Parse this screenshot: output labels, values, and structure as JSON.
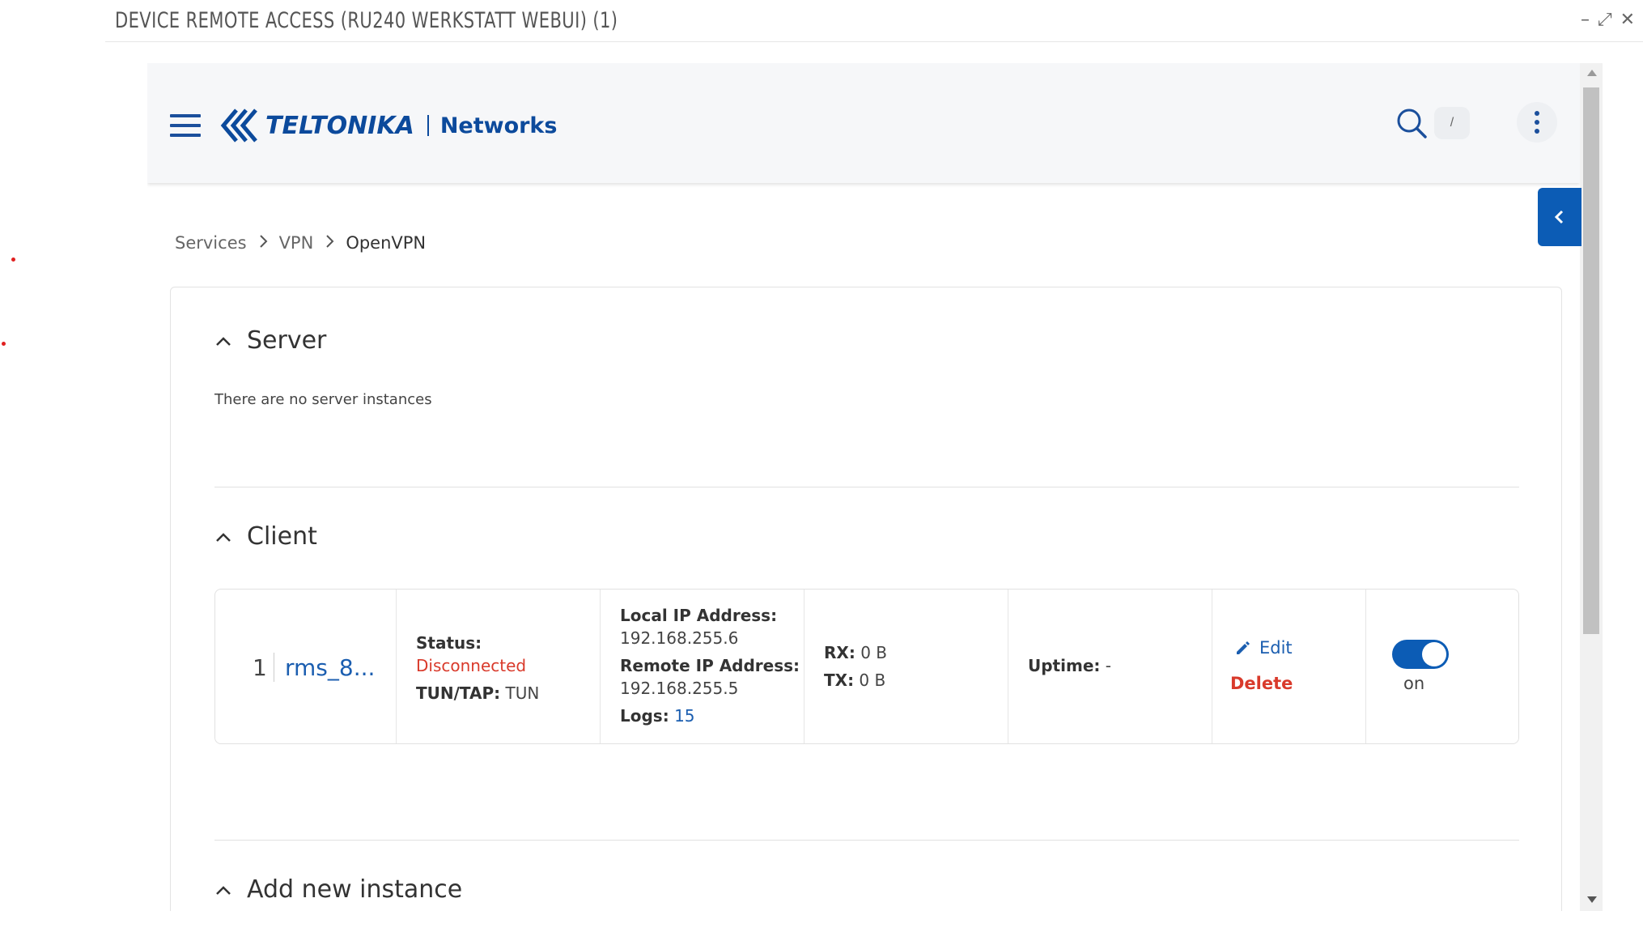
{
  "window": {
    "title": "DEVICE REMOTE ACCESS (RU240 WERKSTATT WEBUI) (1)",
    "controls": {
      "minimize": "–",
      "maximize": "⤢",
      "close": "✕"
    }
  },
  "header": {
    "brand": "TELTONIKA",
    "brand_sub": "Networks",
    "search_shortcut": "/"
  },
  "breadcrumb": [
    "Services",
    "VPN",
    "OpenVPN"
  ],
  "sections": {
    "server": {
      "title": "Server",
      "empty_text": "There are no server instances"
    },
    "client": {
      "title": "Client"
    },
    "add": {
      "title": "Add new instance"
    }
  },
  "instance": {
    "index": "1",
    "name": "rms_8...",
    "status_label": "Status:",
    "status_value": "Disconnected",
    "tuntap_label": "TUN/TAP:",
    "tuntap_value": "TUN",
    "local_ip_label": "Local IP Address:",
    "local_ip_value": "192.168.255.6",
    "remote_ip_label": "Remote IP Address:",
    "remote_ip_value": "192.168.255.5",
    "logs_label": "Logs:",
    "logs_value": "15",
    "rx_label": "RX:",
    "rx_value": "0 B",
    "tx_label": "TX:",
    "tx_value": "0 B",
    "uptime_label": "Uptime:",
    "uptime_value": "-",
    "edit_label": "Edit",
    "delete_label": "Delete",
    "enabled_label": "on"
  },
  "colors": {
    "brand_blue": "#0c4a9c",
    "toggle_blue": "#0c5cb5",
    "link_blue": "#1b5eb0",
    "danger_red": "#d93a2b"
  },
  "icons": [
    "hamburger-menu-icon",
    "teltonika-logo-mark",
    "search-icon",
    "more-vertical-icon",
    "chevron-left-icon",
    "chevron-up-icon",
    "pencil-icon"
  ]
}
